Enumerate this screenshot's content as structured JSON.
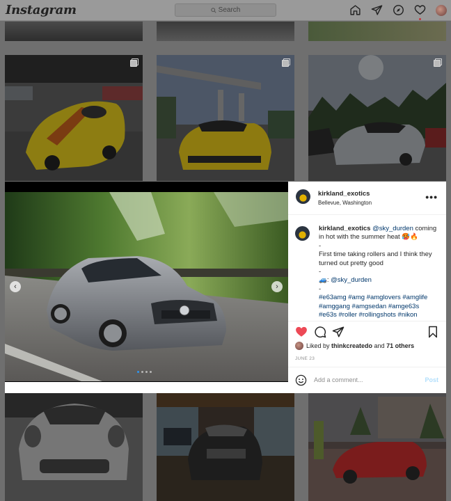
{
  "nav": {
    "logo": "Instagram",
    "search_placeholder": "Search"
  },
  "post": {
    "username": "kirkland_exotics",
    "location": "Bellevue, Washington",
    "more": "•••",
    "caption": {
      "username": "kirkland_exotics",
      "mention": "@sky_durden",
      "text1": " coming in hot with the summer heat 🥵🔥",
      "dash": "-",
      "text2": "First time taking rollers and I think they turned out pretty good",
      "cam_label": "🚙: ",
      "cam_mention": "@sky_durden",
      "tags_line1": "#e63amg #amg #amglovers #amglife",
      "tags_line2": "#amggang #amgsedan #amge63s",
      "tags_line3": "#e63s #roller #rollingshots #nikon"
    },
    "likes": {
      "prefix": "Liked by ",
      "user": "thinkcreatedo",
      "middle": " and ",
      "count": "71 others"
    },
    "date": "JUNE 23",
    "comment_placeholder": "Add a comment...",
    "post_button": "Post",
    "carousel_prev": "‹",
    "carousel_next": "›"
  },
  "colors": {
    "heart": "#ed4956",
    "link": "#00376b",
    "post_button": "#b2dffc"
  }
}
